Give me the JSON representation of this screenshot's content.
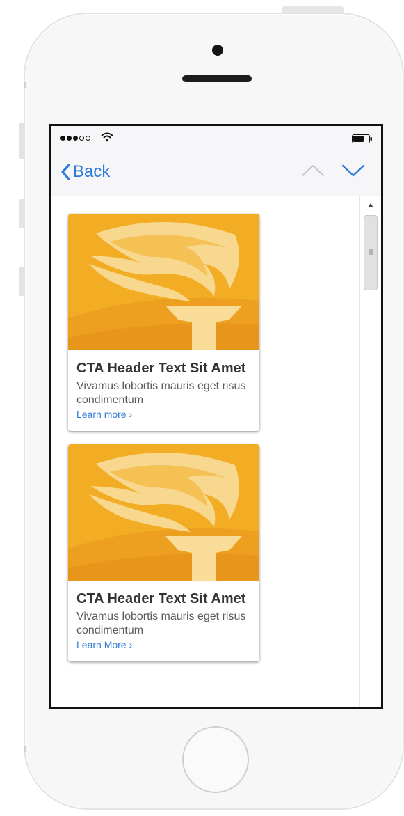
{
  "nav": {
    "back_label": "Back"
  },
  "icons": {
    "back": "chevron-left-icon",
    "prev": "chevron-up-icon",
    "next": "chevron-down-icon",
    "wifi": "wifi-icon",
    "battery": "battery-icon"
  },
  "colors": {
    "accent": "#2f7bd6",
    "card_image_orange": "#f2ad25",
    "torch_light": "#f9dc98"
  },
  "cards": [
    {
      "title": "CTA Header Text Sit Amet",
      "text": "Vivamus lobortis mauris eget risus condimentum",
      "link": "Learn more ›"
    },
    {
      "title": "CTA Header Text Sit Amet",
      "text": "Vivamus lobortis mauris eget risus condimentum",
      "link": "Learn More ›"
    }
  ]
}
